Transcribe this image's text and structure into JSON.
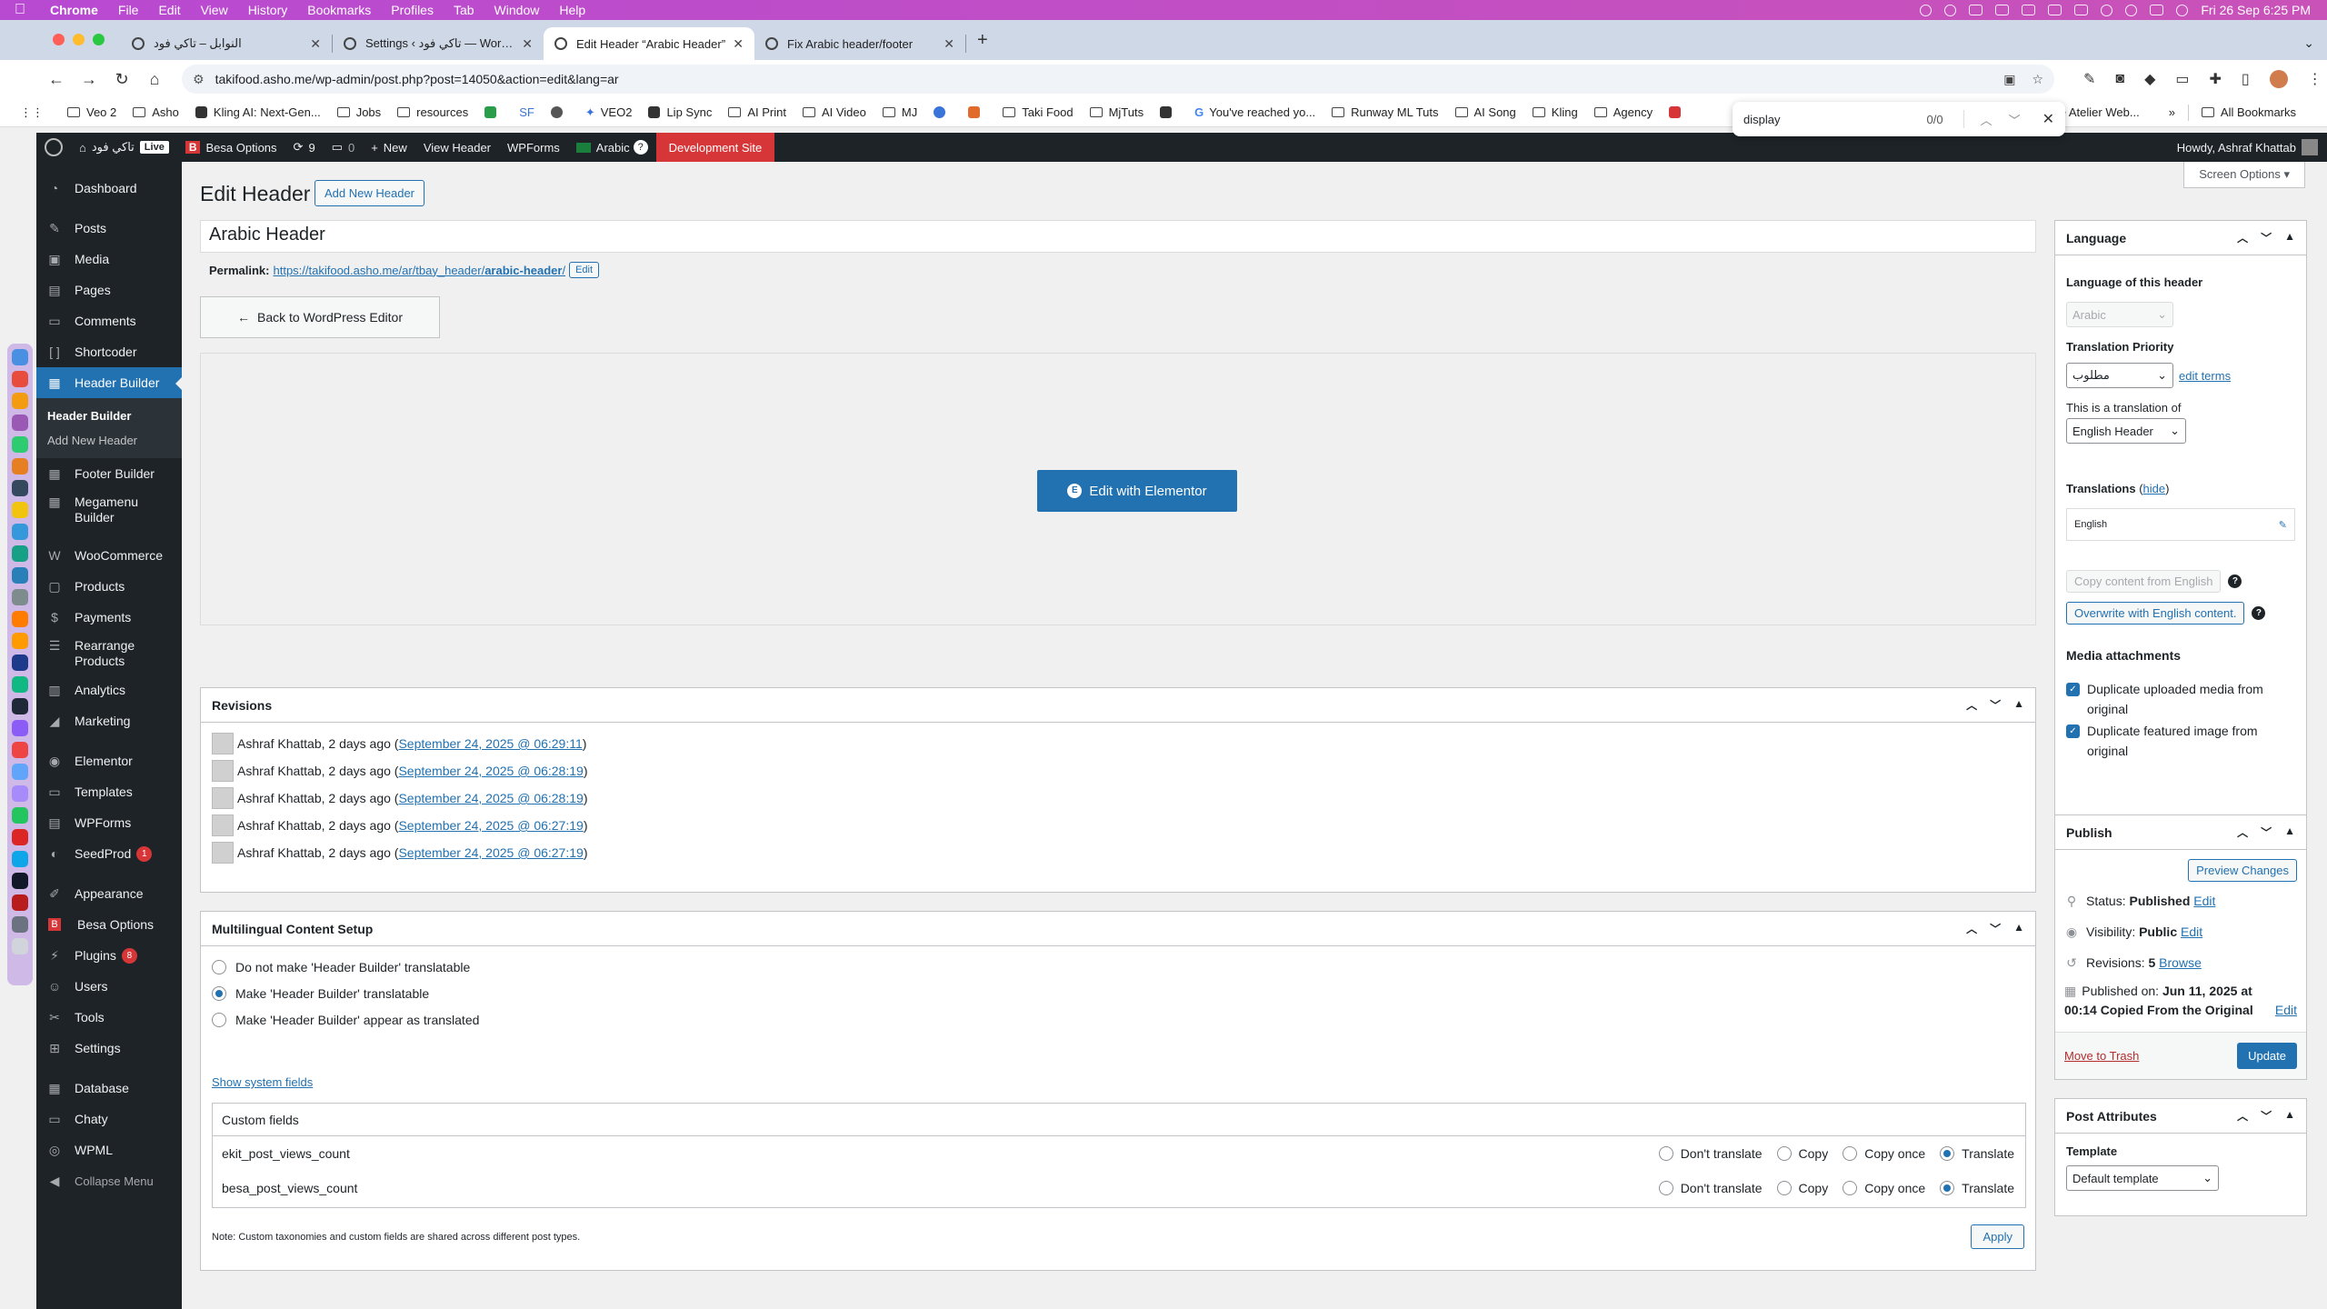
{
  "mac_menubar": {
    "app_name": "Chrome",
    "menus": [
      "File",
      "Edit",
      "View",
      "History",
      "Bookmarks",
      "Profiles",
      "Tab",
      "Window",
      "Help"
    ],
    "clock": "Fri 26 Sep  6:25 PM"
  },
  "tabs": [
    {
      "title": "النوابل – تاكي فود",
      "active": false
    },
    {
      "title": "Settings ‹ تاكي فود — WordPre…",
      "active": false
    },
    {
      "title": "Edit Header “Arabic Header”",
      "active": true
    },
    {
      "title": "Fix Arabic header/footer",
      "active": false
    }
  ],
  "omnibox": {
    "url": "takifood.asho.me/wp-admin/post.php?post=14050&action=edit&lang=ar"
  },
  "bookmarks": {
    "items": [
      "Veo 2",
      "Asho",
      "Kling AI: Next-Gen...",
      "Jobs",
      "resources",
      "SF",
      "VEO2",
      "Lip Sync",
      "AI Print",
      "AI Video",
      "MJ",
      "Taki Food",
      "MjTuts",
      "You've reached yo...",
      "Runway ML Tuts",
      "AI Song",
      "Kling",
      "Agency",
      "e Atelier Web..."
    ],
    "all_bookmarks": "All Bookmarks"
  },
  "findbar": {
    "query": "display",
    "count": "0/0"
  },
  "adminbar": {
    "site_name": "تاكي فود",
    "live": "Live",
    "besa_options": "Besa Options",
    "updates": "9",
    "comments": "0",
    "new": "New",
    "view_header": "View Header",
    "wpforms": "WPForms",
    "language": "Arabic",
    "dev_site": "Development Site",
    "howdy": "Howdy, Ashraf Khattab"
  },
  "sidebar": {
    "dashboard": "Dashboard",
    "posts": "Posts",
    "media": "Media",
    "pages": "Pages",
    "comments": "Comments",
    "shortcoder": "Shortcoder",
    "header_builder": "Header Builder",
    "sub_header_builder": "Header Builder",
    "sub_add_new": "Add New Header",
    "footer_builder": "Footer Builder",
    "megamenu_line1": "Megamenu",
    "megamenu_line2": "Builder",
    "woocommerce": "WooCommerce",
    "products": "Products",
    "payments": "Payments",
    "rearrange_line1": "Rearrange",
    "rearrange_line2": "Products",
    "analytics": "Analytics",
    "marketing": "Marketing",
    "elementor": "Elementor",
    "templates": "Templates",
    "wpforms": "WPForms",
    "seedprod": "SeedProd",
    "seedprod_count": "1",
    "appearance": "Appearance",
    "besa_options": "Besa Options",
    "plugins": "Plugins",
    "plugins_count": "8",
    "users": "Users",
    "tools": "Tools",
    "settings": "Settings",
    "database": "Database",
    "chaty": "Chaty",
    "wpml": "WPML",
    "collapse": "Collapse Menu"
  },
  "page": {
    "screen_options": "Screen Options",
    "title": "Edit Header",
    "add_new": "Add New Header",
    "post_title": "Arabic Header",
    "permalink_label": "Permalink:",
    "permalink_base": "https://takifood.asho.me/ar/tbay_header/",
    "permalink_slug": "arabic-header",
    "permalink_trailing": "/",
    "permalink_edit": "Edit",
    "back_button": "Back to WordPress Editor",
    "elementor_button": "Edit with Elementor"
  },
  "revisions": {
    "title": "Revisions",
    "items": [
      {
        "author": "Ashraf Khattab, 2 days ago (",
        "date": "September 24, 2025 @ 06:29:11",
        "close": ")"
      },
      {
        "author": "Ashraf Khattab, 2 days ago (",
        "date": "September 24, 2025 @ 06:28:19",
        "close": ")"
      },
      {
        "author": "Ashraf Khattab, 2 days ago (",
        "date": "September 24, 2025 @ 06:28:19",
        "close": ")"
      },
      {
        "author": "Ashraf Khattab, 2 days ago (",
        "date": "September 24, 2025 @ 06:27:19",
        "close": ")"
      },
      {
        "author": "Ashraf Khattab, 2 days ago (",
        "date": "September 24, 2025 @ 06:27:19",
        "close": ")"
      }
    ]
  },
  "multilingual": {
    "title": "Multilingual Content Setup",
    "options": [
      {
        "label": "Do not make 'Header Builder' translatable",
        "checked": false
      },
      {
        "label": "Make 'Header Builder' translatable",
        "checked": true
      },
      {
        "label": "Make 'Header Builder' appear as translated",
        "checked": false
      }
    ],
    "show_system_fields": "Show system fields",
    "custom_fields_title": "Custom fields",
    "fields": [
      {
        "name": "ekit_post_views_count",
        "selected": "Translate"
      },
      {
        "name": "besa_post_views_count",
        "selected": "Translate"
      }
    ],
    "field_options": [
      "Don't translate",
      "Copy",
      "Copy once",
      "Translate"
    ],
    "note": "Note: Custom taxonomies and custom fields are shared across different post types.",
    "apply": "Apply"
  },
  "language_box": {
    "title": "Language",
    "language_label": "Language of this header",
    "language_value": "Arabic",
    "priority_label": "Translation Priority",
    "priority_value": "مطلوب",
    "edit_terms": "edit terms",
    "translation_of_label": "This is a translation of",
    "translation_of_value": "English Header",
    "translations_label": "Translations",
    "hide": "hide",
    "translation_lang": "English",
    "copy_content": "Copy content from English",
    "overwrite": "Overwrite with English content.",
    "media_label": "Media attachments",
    "dup_media": "Duplicate uploaded media from original",
    "dup_featured": "Duplicate featured image from original"
  },
  "publish_box": {
    "title": "Publish",
    "preview": "Preview Changes",
    "status_label": "Status:",
    "status_value": "Published",
    "visibility_label": "Visibility:",
    "visibility_value": "Public",
    "revisions_label": "Revisions:",
    "revisions_value": "5",
    "browse": "Browse",
    "published_on_label": "Published on:",
    "published_on_value": "Jun 11, 2025 at",
    "published_line2": "00:14 Copied From the Original",
    "edit": "Edit",
    "trash": "Move to Trash",
    "update": "Update"
  },
  "attributes_box": {
    "title": "Post Attributes",
    "template_label": "Template",
    "template_value": "Default template"
  },
  "colors": {
    "wp_blue": "#2271b1",
    "admin_dark": "#1d2327",
    "dev_red": "#d63638"
  }
}
